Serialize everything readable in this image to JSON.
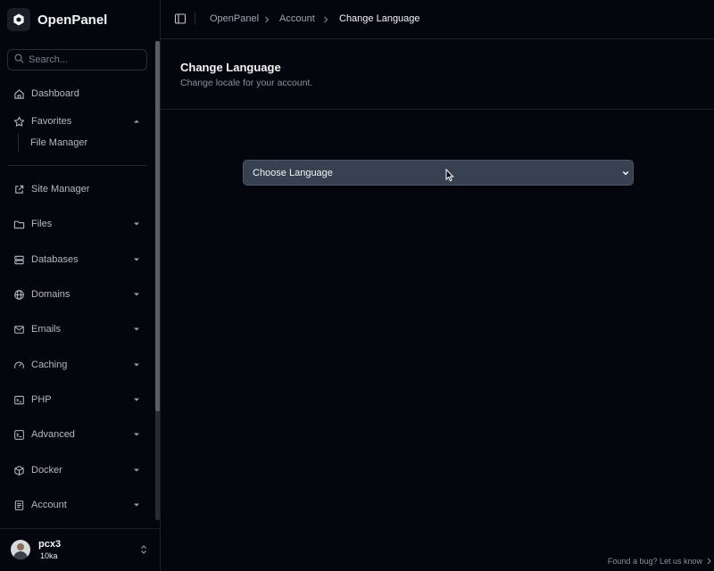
{
  "brand": {
    "name": "OpenPanel"
  },
  "search": {
    "placeholder": "Search..."
  },
  "sidebar": {
    "items": [
      {
        "label": "Dashboard",
        "icon": "home-icon"
      },
      {
        "label": "Favorites",
        "icon": "star-icon",
        "expanded": true
      },
      {
        "label": "Site Manager",
        "icon": "external-link-icon"
      },
      {
        "label": "Files",
        "icon": "folder-icon"
      },
      {
        "label": "Databases",
        "icon": "database-icon"
      },
      {
        "label": "Domains",
        "icon": "globe-icon"
      },
      {
        "label": "Emails",
        "icon": "mail-icon"
      },
      {
        "label": "Caching",
        "icon": "gauge-icon"
      },
      {
        "label": "PHP",
        "icon": "terminal-icon"
      },
      {
        "label": "Advanced",
        "icon": "terminal-square-icon"
      },
      {
        "label": "Docker",
        "icon": "box-icon"
      },
      {
        "label": "Account",
        "icon": "document-icon"
      }
    ],
    "favorites": [
      "File Manager"
    ]
  },
  "user": {
    "name": "pcx3",
    "subtitle": "10ka"
  },
  "breadcrumb": [
    "OpenPanel",
    "Account",
    "Change Language"
  ],
  "page": {
    "title": "Change Language",
    "subtitle": "Change locale for your account."
  },
  "language_select": {
    "selected": "Choose Language"
  },
  "footer": {
    "bug_link": "Found a bug? Let us know"
  },
  "colors": {
    "background": "#05060d",
    "select_bg": "#374151",
    "border": "#1d1f27"
  }
}
